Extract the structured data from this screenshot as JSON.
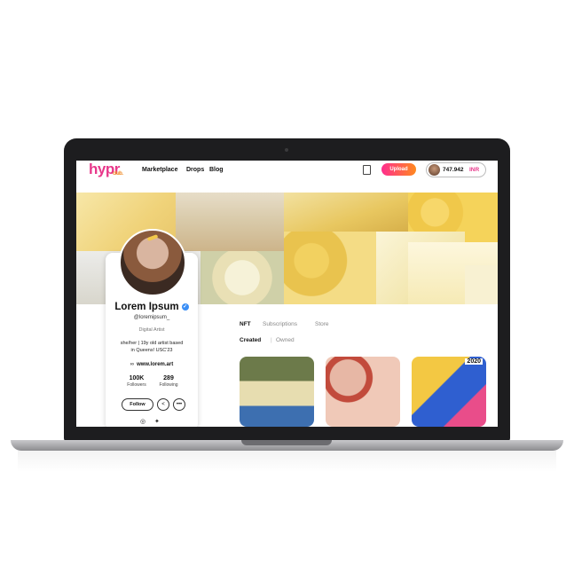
{
  "nav": {
    "logo": "hypr",
    "logo_sub": "club.",
    "links": [
      "Marketplace",
      "Drops",
      "Blog"
    ],
    "upload_label": "Upload",
    "wallet_amount": "747.942",
    "wallet_currency": "INR"
  },
  "profile": {
    "name": "Lorem Ipsum",
    "handle": "@loremipsum_",
    "role": "Digital Artist",
    "bio_line1": "she/her | 19y old artist based",
    "bio_line2": "in Queens! USC'23",
    "website": "www.lorem.art",
    "followers_count": "100K",
    "followers_label": "Followers",
    "following_count": "289",
    "following_label": "Following",
    "follow_label": "Follow"
  },
  "tabs": [
    "NFT",
    "Subscriptions",
    "Store"
  ],
  "subtabs": [
    "Created",
    "Owned"
  ],
  "nft_badge": "2020",
  "colors": {
    "accent_pink": "#e8388b",
    "accent_orange": "#ff8a1e",
    "banner_yellow": "#f3dd8a",
    "verified_blue": "#3a8ef6"
  }
}
